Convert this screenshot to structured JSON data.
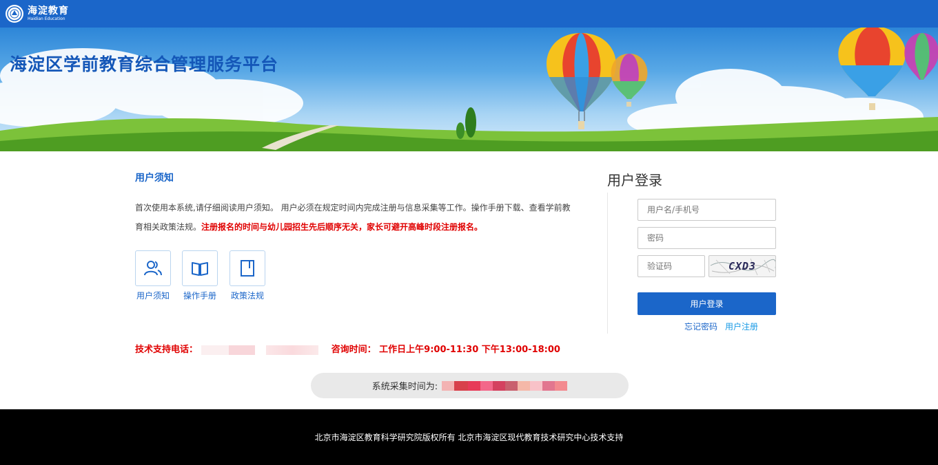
{
  "header": {
    "logo_text": "海淀教育",
    "logo_subtext": "Haidian Education",
    "colors": {
      "topbar": "#1b66c9"
    }
  },
  "banner": {
    "title": "海淀区学前教育综合管理服务平台"
  },
  "notice": {
    "title": "用户须知",
    "text": "首次使用本系统,请仔细阅读用户须知。 用户必须在规定时间内完成注册与信息采集等工作。操作手册下载、查看学前教育相关政策法规。",
    "warning": "注册报名的时间与幼儿园招生先后顺序无关，家长可避开高峰时段注册报名。"
  },
  "quick_links": [
    {
      "label": "用户须知",
      "icon": "users-icon"
    },
    {
      "label": "操作手册",
      "icon": "open-book-icon"
    },
    {
      "label": "政策法规",
      "icon": "document-icon"
    }
  ],
  "support": {
    "phone_label": "技术支持电话：",
    "hours_label": "咨询时间：",
    "hours": "工作日上午9:00-11:30  下午13:00-18:00"
  },
  "collection": {
    "label": "系统采集时间为:"
  },
  "login": {
    "title": "用户登录",
    "username_placeholder": "用户名/手机号",
    "password_placeholder": "密码",
    "captcha_placeholder": "验证码",
    "captcha_code": "CXD3",
    "submit_label": "用户登录",
    "forgot_label": "忘记密码",
    "register_label": "用户注册"
  },
  "footer": {
    "copyright": "北京市海淀区教育科学研究院版权所有 北京市海淀区现代教育技术研究中心技术支持"
  }
}
